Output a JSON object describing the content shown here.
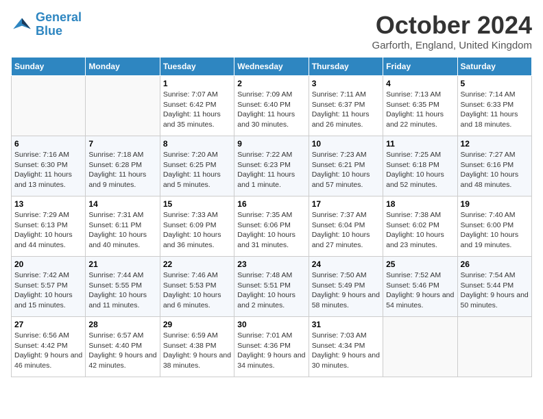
{
  "header": {
    "logo_line1": "General",
    "logo_line2": "Blue",
    "month_title": "October 2024",
    "location": "Garforth, England, United Kingdom"
  },
  "weekdays": [
    "Sunday",
    "Monday",
    "Tuesday",
    "Wednesday",
    "Thursday",
    "Friday",
    "Saturday"
  ],
  "weeks": [
    [
      {
        "day": "",
        "sunrise": "",
        "sunset": "",
        "daylight": ""
      },
      {
        "day": "",
        "sunrise": "",
        "sunset": "",
        "daylight": ""
      },
      {
        "day": "1",
        "sunrise": "Sunrise: 7:07 AM",
        "sunset": "Sunset: 6:42 PM",
        "daylight": "Daylight: 11 hours and 35 minutes."
      },
      {
        "day": "2",
        "sunrise": "Sunrise: 7:09 AM",
        "sunset": "Sunset: 6:40 PM",
        "daylight": "Daylight: 11 hours and 30 minutes."
      },
      {
        "day": "3",
        "sunrise": "Sunrise: 7:11 AM",
        "sunset": "Sunset: 6:37 PM",
        "daylight": "Daylight: 11 hours and 26 minutes."
      },
      {
        "day": "4",
        "sunrise": "Sunrise: 7:13 AM",
        "sunset": "Sunset: 6:35 PM",
        "daylight": "Daylight: 11 hours and 22 minutes."
      },
      {
        "day": "5",
        "sunrise": "Sunrise: 7:14 AM",
        "sunset": "Sunset: 6:33 PM",
        "daylight": "Daylight: 11 hours and 18 minutes."
      }
    ],
    [
      {
        "day": "6",
        "sunrise": "Sunrise: 7:16 AM",
        "sunset": "Sunset: 6:30 PM",
        "daylight": "Daylight: 11 hours and 13 minutes."
      },
      {
        "day": "7",
        "sunrise": "Sunrise: 7:18 AM",
        "sunset": "Sunset: 6:28 PM",
        "daylight": "Daylight: 11 hours and 9 minutes."
      },
      {
        "day": "8",
        "sunrise": "Sunrise: 7:20 AM",
        "sunset": "Sunset: 6:25 PM",
        "daylight": "Daylight: 11 hours and 5 minutes."
      },
      {
        "day": "9",
        "sunrise": "Sunrise: 7:22 AM",
        "sunset": "Sunset: 6:23 PM",
        "daylight": "Daylight: 11 hours and 1 minute."
      },
      {
        "day": "10",
        "sunrise": "Sunrise: 7:23 AM",
        "sunset": "Sunset: 6:21 PM",
        "daylight": "Daylight: 10 hours and 57 minutes."
      },
      {
        "day": "11",
        "sunrise": "Sunrise: 7:25 AM",
        "sunset": "Sunset: 6:18 PM",
        "daylight": "Daylight: 10 hours and 52 minutes."
      },
      {
        "day": "12",
        "sunrise": "Sunrise: 7:27 AM",
        "sunset": "Sunset: 6:16 PM",
        "daylight": "Daylight: 10 hours and 48 minutes."
      }
    ],
    [
      {
        "day": "13",
        "sunrise": "Sunrise: 7:29 AM",
        "sunset": "Sunset: 6:13 PM",
        "daylight": "Daylight: 10 hours and 44 minutes."
      },
      {
        "day": "14",
        "sunrise": "Sunrise: 7:31 AM",
        "sunset": "Sunset: 6:11 PM",
        "daylight": "Daylight: 10 hours and 40 minutes."
      },
      {
        "day": "15",
        "sunrise": "Sunrise: 7:33 AM",
        "sunset": "Sunset: 6:09 PM",
        "daylight": "Daylight: 10 hours and 36 minutes."
      },
      {
        "day": "16",
        "sunrise": "Sunrise: 7:35 AM",
        "sunset": "Sunset: 6:06 PM",
        "daylight": "Daylight: 10 hours and 31 minutes."
      },
      {
        "day": "17",
        "sunrise": "Sunrise: 7:37 AM",
        "sunset": "Sunset: 6:04 PM",
        "daylight": "Daylight: 10 hours and 27 minutes."
      },
      {
        "day": "18",
        "sunrise": "Sunrise: 7:38 AM",
        "sunset": "Sunset: 6:02 PM",
        "daylight": "Daylight: 10 hours and 23 minutes."
      },
      {
        "day": "19",
        "sunrise": "Sunrise: 7:40 AM",
        "sunset": "Sunset: 6:00 PM",
        "daylight": "Daylight: 10 hours and 19 minutes."
      }
    ],
    [
      {
        "day": "20",
        "sunrise": "Sunrise: 7:42 AM",
        "sunset": "Sunset: 5:57 PM",
        "daylight": "Daylight: 10 hours and 15 minutes."
      },
      {
        "day": "21",
        "sunrise": "Sunrise: 7:44 AM",
        "sunset": "Sunset: 5:55 PM",
        "daylight": "Daylight: 10 hours and 11 minutes."
      },
      {
        "day": "22",
        "sunrise": "Sunrise: 7:46 AM",
        "sunset": "Sunset: 5:53 PM",
        "daylight": "Daylight: 10 hours and 6 minutes."
      },
      {
        "day": "23",
        "sunrise": "Sunrise: 7:48 AM",
        "sunset": "Sunset: 5:51 PM",
        "daylight": "Daylight: 10 hours and 2 minutes."
      },
      {
        "day": "24",
        "sunrise": "Sunrise: 7:50 AM",
        "sunset": "Sunset: 5:49 PM",
        "daylight": "Daylight: 9 hours and 58 minutes."
      },
      {
        "day": "25",
        "sunrise": "Sunrise: 7:52 AM",
        "sunset": "Sunset: 5:46 PM",
        "daylight": "Daylight: 9 hours and 54 minutes."
      },
      {
        "day": "26",
        "sunrise": "Sunrise: 7:54 AM",
        "sunset": "Sunset: 5:44 PM",
        "daylight": "Daylight: 9 hours and 50 minutes."
      }
    ],
    [
      {
        "day": "27",
        "sunrise": "Sunrise: 6:56 AM",
        "sunset": "Sunset: 4:42 PM",
        "daylight": "Daylight: 9 hours and 46 minutes."
      },
      {
        "day": "28",
        "sunrise": "Sunrise: 6:57 AM",
        "sunset": "Sunset: 4:40 PM",
        "daylight": "Daylight: 9 hours and 42 minutes."
      },
      {
        "day": "29",
        "sunrise": "Sunrise: 6:59 AM",
        "sunset": "Sunset: 4:38 PM",
        "daylight": "Daylight: 9 hours and 38 minutes."
      },
      {
        "day": "30",
        "sunrise": "Sunrise: 7:01 AM",
        "sunset": "Sunset: 4:36 PM",
        "daylight": "Daylight: 9 hours and 34 minutes."
      },
      {
        "day": "31",
        "sunrise": "Sunrise: 7:03 AM",
        "sunset": "Sunset: 4:34 PM",
        "daylight": "Daylight: 9 hours and 30 minutes."
      },
      {
        "day": "",
        "sunrise": "",
        "sunset": "",
        "daylight": ""
      },
      {
        "day": "",
        "sunrise": "",
        "sunset": "",
        "daylight": ""
      }
    ]
  ]
}
